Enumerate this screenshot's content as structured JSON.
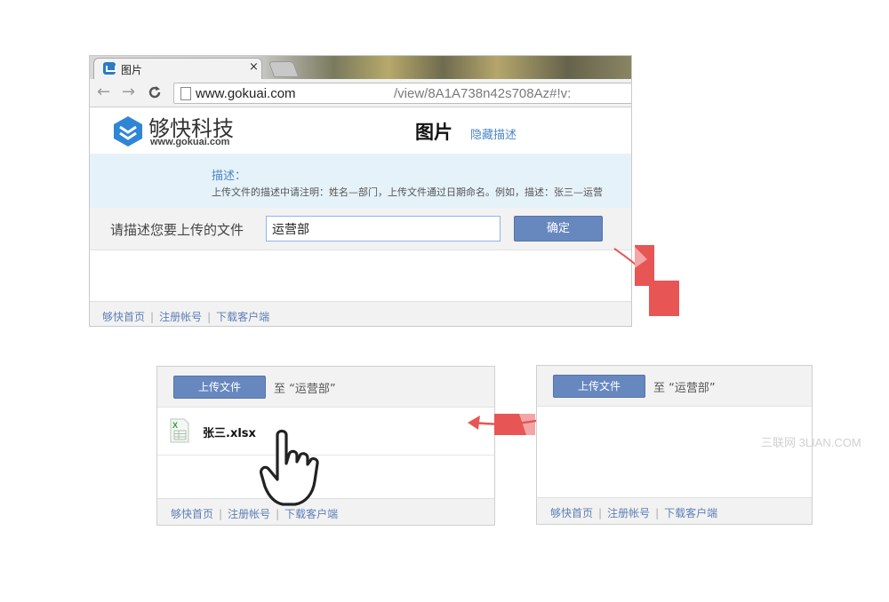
{
  "browser": {
    "tab_title": "图片",
    "close_glyph": "×",
    "url_host": "www.gokuai.com",
    "url_path": "/view/8A1A738n42s708Az#!v:",
    "back_icon": "←",
    "forward_icon": "→",
    "reload_icon": "C"
  },
  "site": {
    "brand_name": "够快科技",
    "brand_domain": "www.gokuai.com",
    "page_heading": "图片",
    "hide_desc_link": "隐藏描述",
    "desc_label": "描述：",
    "desc_text": "上传文件的描述中请注明：姓名—部门，上传文件通过日期命名。例如，描述：张三—运营",
    "form_label": "请描述您要上传的文件",
    "input_value": "运营部",
    "confirm_label": "确定",
    "footer": [
      "够快首页",
      "注册帐号",
      "下载客户端"
    ],
    "footer_sep": "|"
  },
  "panel_left": {
    "upload_label": "上传文件",
    "target_text": "至 “运营部”",
    "file_name": "张三.xlsx",
    "file_icon_letter": "X",
    "footer": [
      "够快首页",
      "注册帐号",
      "下载客户端"
    ]
  },
  "panel_right": {
    "upload_label": "上传文件",
    "target_text": "至 “运营部”",
    "footer": [
      "够快首页",
      "注册帐号",
      "下载客户端"
    ]
  },
  "watermark": "三联网 3LIAN.COM",
  "colors": {
    "accent_button": "#6788bf",
    "link_blue": "#4a86c6",
    "arrow_red": "#e85555",
    "desc_bg": "#e6f2fa"
  }
}
